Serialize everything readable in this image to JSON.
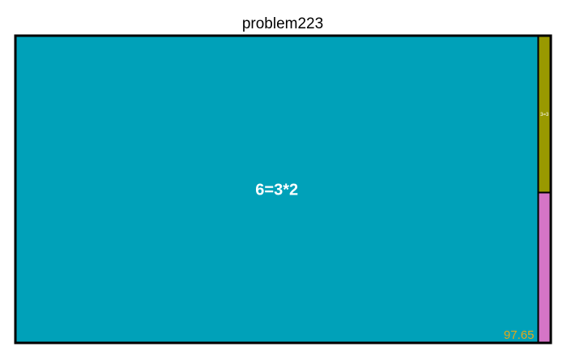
{
  "chart_data": {
    "type": "treemap",
    "title": "problem223",
    "border_color": "#000000",
    "series": [
      {
        "label": "6=3*2",
        "value": 97.65,
        "color": "#00A1B9"
      },
      {
        "label": "3=3",
        "value": 1.2,
        "color": "#999900"
      },
      {
        "label": "",
        "value": 1.15,
        "color": "#D575C6"
      }
    ],
    "value_label": {
      "text": "97.65",
      "color": "#E6A817"
    }
  }
}
